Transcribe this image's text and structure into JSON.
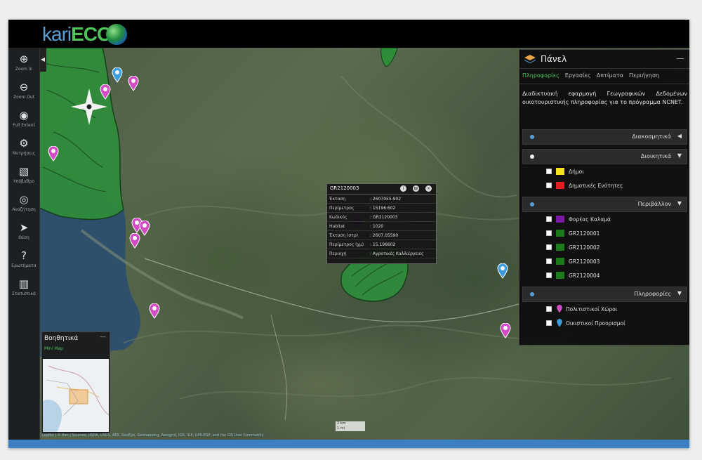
{
  "app": {
    "logo_part1": "kari",
    "logo_part2": "ECO"
  },
  "toolbar": [
    {
      "label": "Zoom In",
      "icon": "zoom-in-icon",
      "glyph": "⊕"
    },
    {
      "label": "Zoom Out",
      "icon": "zoom-out-icon",
      "glyph": "⊖"
    },
    {
      "label": "Full Extent",
      "icon": "globe-icon",
      "glyph": "◉"
    },
    {
      "label": "Μετρήσεις",
      "icon": "measure-icon",
      "glyph": "⚙"
    },
    {
      "label": "Υπόβαθρο",
      "icon": "basemap-icon",
      "glyph": "▧"
    },
    {
      "label": "Αναζήτηση",
      "icon": "binoculars-icon",
      "glyph": "◎"
    },
    {
      "label": "Θέση",
      "icon": "location-arrow-icon",
      "glyph": "➤"
    },
    {
      "label": "Ερωτήματα",
      "icon": "question-icon",
      "glyph": "?"
    },
    {
      "label": "Στατιστικά",
      "icon": "statistics-icon",
      "glyph": "▥"
    }
  ],
  "panel": {
    "title": "Πάνελ",
    "minimize": "—",
    "tabs": [
      "Πληροφορίες",
      "Εργασίες",
      "Απτίματα",
      "Περιήγηση"
    ],
    "description": "Διαδικτυακή εφαρμογή Γεωγραφικών Δεδομένων οικοτουριστικής πληροφορίας για το πρόγραμμα NCNET.",
    "sections": [
      {
        "title": "Διακοσμητικά",
        "arrow": "◀",
        "dot": "blue",
        "items": []
      },
      {
        "title": "Διοικητικά",
        "arrow": "▼",
        "dot": "white",
        "items": [
          {
            "label": "Δήμοι",
            "color": "#f5e21a"
          },
          {
            "label": "Δημοτικές Ενότητες",
            "color": "#e01e1e"
          }
        ]
      },
      {
        "title": "Περιβάλλον",
        "arrow": "▼",
        "dot": "blue",
        "items": [
          {
            "label": "Φορέας Καλαμά",
            "color": "#7b1aa0"
          },
          {
            "label": "GR2120001",
            "color": "#1b7a1b"
          },
          {
            "label": "GR2120002",
            "color": "#1b7a1b"
          },
          {
            "label": "GR2120003",
            "color": "#1b7a1b"
          },
          {
            "label": "GR2120004",
            "color": "#1b7a1b"
          }
        ]
      },
      {
        "title": "Πληροφορίες",
        "arrow": "▼",
        "dot": "blue",
        "items": [
          {
            "label": "Πολιτιστικοί Χώροι",
            "color": "#d44cc4",
            "pin": true
          },
          {
            "label": "Οικιστικοί Προορισμοί",
            "color": "#3a9ee0",
            "pin": true
          }
        ]
      }
    ]
  },
  "popup": {
    "title": "GR2120003",
    "rows": [
      {
        "k": "Έκταση",
        "v": ": 2607055.902"
      },
      {
        "k": "Περίμετρος",
        "v": ": 15196.602"
      },
      {
        "k": "Κωδικός",
        "v": ": GR2120003"
      },
      {
        "k": "Habitat",
        "v": ": 1020"
      },
      {
        "k": "Έκταση (στρ)",
        "v": ": 2607.05590"
      },
      {
        "k": "Περίμετρος (χμ)",
        "v": ": 15.196602"
      },
      {
        "k": "Περιοχή",
        "v": ": Αγροτικές Καλλιέργειες"
      }
    ]
  },
  "minimap": {
    "title": "Βοηθητικά",
    "minimize": "—",
    "tab": "Mini Map"
  },
  "attribution": "Leaflet | © Esri | Sources: USDA, USGS, AEX, GeoEye, Getmapping, Aerogrid, IGN, IGP, UPR-EGP, and the GIS User Community",
  "scale": {
    "line1": "2 km",
    "line2": "1 mi"
  }
}
